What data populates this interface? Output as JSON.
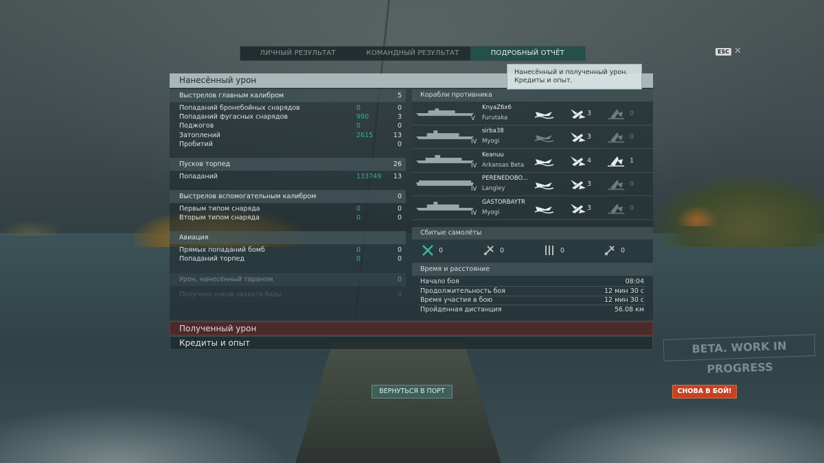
{
  "tabs": [
    {
      "label": "ЛИЧНЫЙ РЕЗУЛЬТАТ",
      "active": false
    },
    {
      "label": "КОМАНДНЫЙ РЕЗУЛЬТАТ",
      "active": false
    },
    {
      "label": "ПОДРОБНЫЙ ОТЧЁТ",
      "active": true
    }
  ],
  "esc_key": "ESC",
  "close_glyph": "✕",
  "tooltip": {
    "line1": "Нанесённый и полученный урон.",
    "line2": "Кредиты и опыт."
  },
  "damage": {
    "title": "Нанесённый урон",
    "main_battery": {
      "label": "Выстрелов главным калибром",
      "value": "5",
      "rows": [
        {
          "label": "Попаданий бронебойных снарядов",
          "hits": "0",
          "value": "0"
        },
        {
          "label": "Попаданий фугасных снарядов",
          "hits": "990",
          "value": "3"
        },
        {
          "label": "Поджогов",
          "hits": "0",
          "value": "0"
        },
        {
          "label": "Затоплений",
          "hits": "2615",
          "value": "13"
        },
        {
          "label": "Пробитий",
          "hits": "",
          "value": "0"
        }
      ]
    },
    "torpedoes": {
      "label": "Пусков торпед",
      "value": "26",
      "rows": [
        {
          "label": "Попаданий",
          "hits": "133749",
          "value": "13"
        }
      ]
    },
    "secondary": {
      "label": "Выстрелов вспомогательным калибром",
      "value": "0",
      "rows": [
        {
          "label": "Первым типом снаряда",
          "hits": "0",
          "value": "0"
        },
        {
          "label": "Вторым типом снаряда",
          "hits": "0",
          "value": "0"
        }
      ]
    },
    "aviation": {
      "label": "Авиация",
      "value": "",
      "rows": [
        {
          "label": "Прямых попаданий бомб",
          "hits": "0",
          "value": "0"
        },
        {
          "label": "Попаданий торпед",
          "hits": "0",
          "value": "0"
        }
      ]
    },
    "ram": {
      "label": "Урон, нанесённый тараном",
      "value": "0"
    },
    "capture": {
      "label": "Получено очков захвата базы",
      "value": "0"
    }
  },
  "enemy_ships": {
    "title": "Корабли противника",
    "ships": [
      {
        "nick": "KnyaZ6x6",
        "ship": "Furutaka",
        "tier": "V",
        "a": "3",
        "b": "0",
        "b_active": false
      },
      {
        "nick": "sirba38",
        "ship": "Myogi",
        "tier": "IV",
        "a": "3",
        "b": "0",
        "b_active": false
      },
      {
        "nick": "Keanuu",
        "ship": "Arkansas Beta",
        "tier": "IV",
        "a": "4",
        "b": "1",
        "b_active": true
      },
      {
        "nick": "PERENEDOBO...",
        "ship": "Langley",
        "tier": "IV",
        "a": "3",
        "b": "0",
        "b_active": false
      },
      {
        "nick": "GASTORBAYTR",
        "ship": "Myogi",
        "tier": "IV",
        "a": "3",
        "b": "0",
        "b_active": false
      }
    ]
  },
  "planes": {
    "title": "Сбитые самолёты",
    "items": [
      {
        "icon": "fighter-icon",
        "value": "0"
      },
      {
        "icon": "torpedo-bomber-icon",
        "value": "0"
      },
      {
        "icon": "dive-bomber-icon",
        "value": "0"
      },
      {
        "icon": "spotter-plane-icon",
        "value": "0"
      }
    ]
  },
  "time": {
    "title": "Время и расстояние",
    "rows": [
      {
        "label": "Начало боя",
        "value": "08:04"
      },
      {
        "label": "Продолжительность боя",
        "value": "12 мин 30 с"
      },
      {
        "label": "Время участия в бою",
        "value": "12 мин 30 с"
      },
      {
        "label": "Пройденная дистанция",
        "value": "56.08 км"
      }
    ]
  },
  "received_damage": "Полученный урон",
  "credits_xp": "Кредиты и опыт",
  "back_to_port": "ВЕРНУТЬСЯ В ПОРТ",
  "to_battle": "СНОВА В БОЙ!",
  "beta_watermark": "BETA. WORK IN PROGRESS",
  "colors": {
    "accent_green": "#2fb59a",
    "active_tab": "#244f4a",
    "battle_button": "#c74220",
    "received_bar": "#4a2a2a"
  }
}
